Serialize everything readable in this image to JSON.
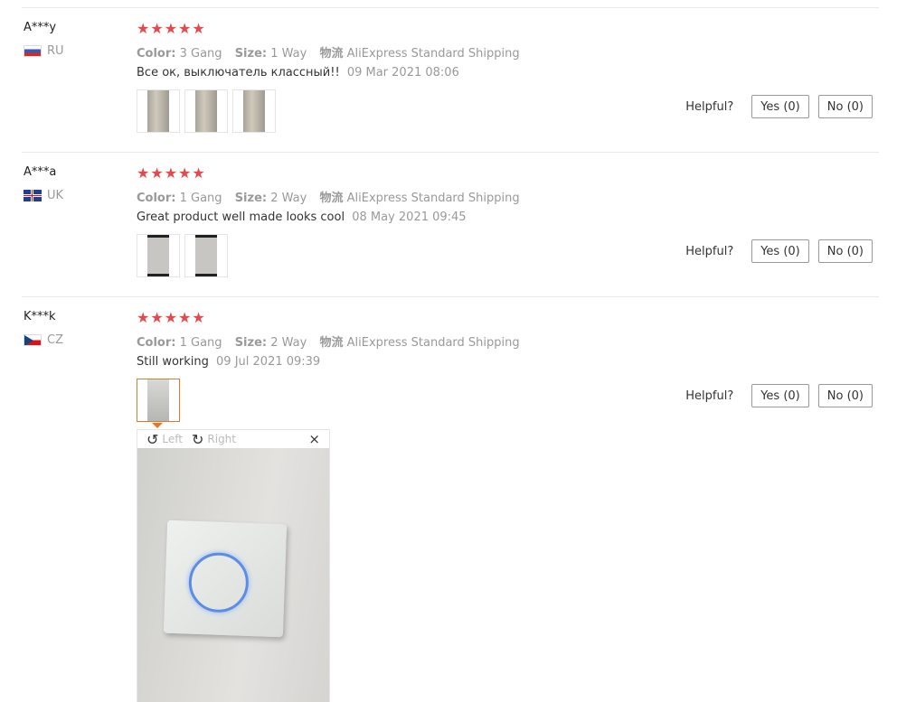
{
  "reviews": [
    {
      "user": "A***y",
      "country": "RU",
      "stars": "★★★★★",
      "color_label": "Color:",
      "color_value": "3 Gang",
      "size_label": "Size:",
      "size_value": "1 Way",
      "logistics_label": "物流",
      "logistics_value": "AliExpress Standard Shipping",
      "text": "Все ок, выключатель классный!!",
      "date": "09 Mar 2021 08:06",
      "helpful_label": "Helpful?",
      "yes_label": "Yes (0)",
      "no_label": "No (0)"
    },
    {
      "user": "A***a",
      "country": "UK",
      "stars": "★★★★★",
      "color_label": "Color:",
      "color_value": "1 Gang",
      "size_label": "Size:",
      "size_value": "2 Way",
      "logistics_label": "物流",
      "logistics_value": "AliExpress Standard Shipping",
      "text": "Great product well made looks cool",
      "date": "08 May 2021 09:45",
      "helpful_label": "Helpful?",
      "yes_label": "Yes (0)",
      "no_label": "No (0)"
    },
    {
      "user": "K***k",
      "country": "CZ",
      "stars": "★★★★★",
      "color_label": "Color:",
      "color_value": "1 Gang",
      "size_label": "Size:",
      "size_value": "2 Way",
      "logistics_label": "物流",
      "logistics_value": "AliExpress Standard Shipping",
      "text": "Still working",
      "date": "09 Jul 2021 09:39",
      "helpful_label": "Helpful?",
      "yes_label": "Yes (0)",
      "no_label": "No (0)"
    }
  ],
  "viewer": {
    "rotate_left_label": "Left",
    "rotate_right_label": "Right",
    "close": "×",
    "rotate_left_icon": "↺",
    "rotate_right_icon": "↻"
  },
  "colors": {
    "star": "#e5484d",
    "active_thumb": "#e07a2b"
  }
}
